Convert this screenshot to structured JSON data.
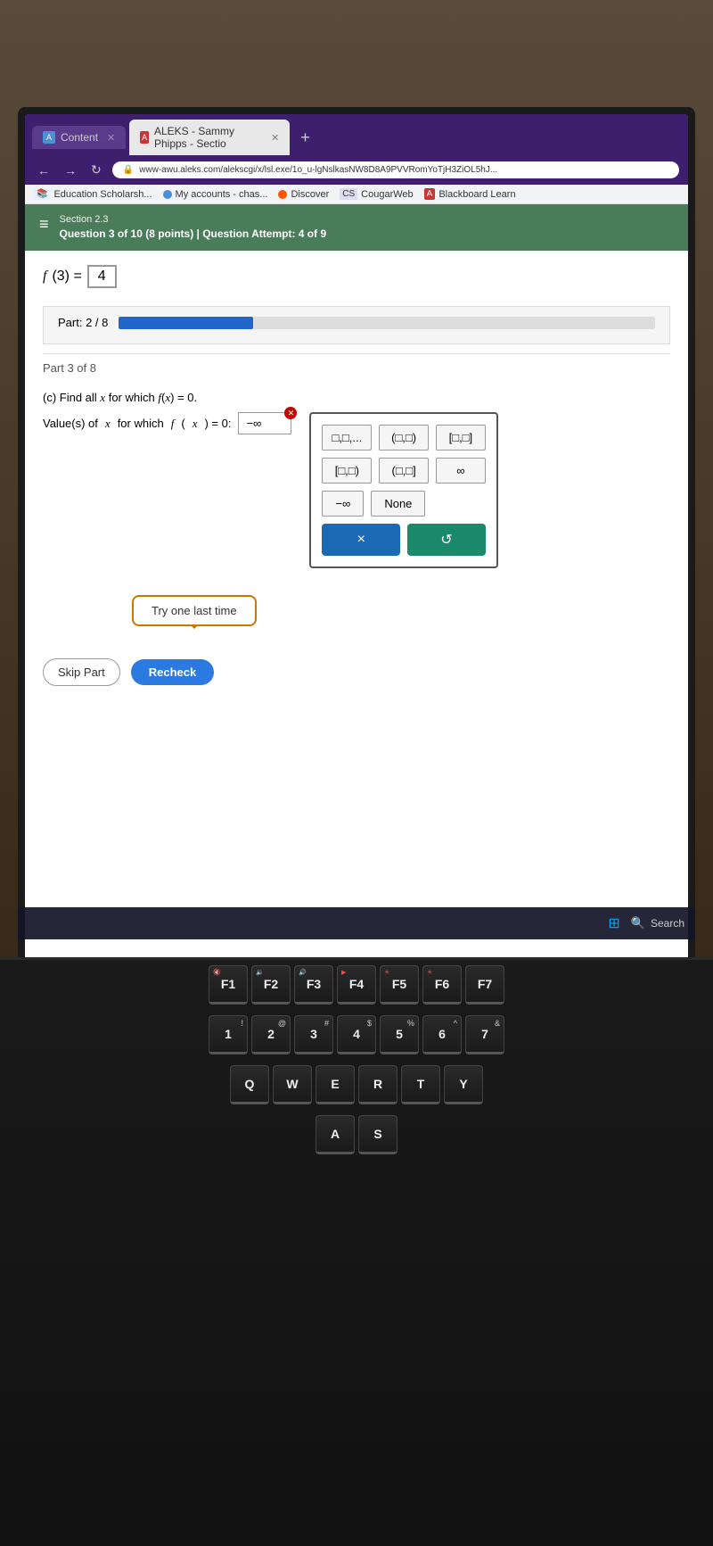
{
  "desk": {
    "bg_color": "#3a2a1a"
  },
  "browser": {
    "tabs": [
      {
        "id": "tab1",
        "label": "Content",
        "icon_color": "#4a90d9",
        "active": false,
        "icon": "A"
      },
      {
        "id": "tab2",
        "label": "ALEKS - Sammy Phipps - Sectio",
        "icon_color": "#cc3333",
        "active": true,
        "icon": "A"
      }
    ],
    "url": "www-awu.aleks.com/alekscgi/x/lsl.exe/1o_u-lgNslkasNW8D8A9PVVRomYoTjH3ZiOL5hJ...",
    "bookmarks": [
      {
        "label": "Education Scholarsh...",
        "type": "image"
      },
      {
        "label": "My accounts - chas...",
        "type": "circle",
        "color": "#4a90d9"
      },
      {
        "label": "Discover",
        "type": "circle",
        "color": "#ff5500"
      },
      {
        "label": "CougarWeb",
        "type": "image"
      },
      {
        "label": "Blackboard Learn",
        "type": "A_icon"
      }
    ]
  },
  "aleks": {
    "section": "Section 2.3",
    "question_info": "Question 3 of 10 (8 points)  |  Question Attempt: 4 of 9",
    "f3_equation": "f(3) =",
    "f3_answer": "4",
    "progress": {
      "label": "Part: 2 / 8",
      "fill_percent": 25
    },
    "part_label": "Part 3 of 8",
    "part_c_text": "(c) Find all x for which f(x) = 0.",
    "value_label": "Value(s) of x for which f(x) = 0:",
    "input_value": "−∞",
    "interval_popup": {
      "row1": [
        "□,□,...",
        "(□,□)",
        "[□,□]"
      ],
      "row2": [
        "[□,□)",
        "(□,□]",
        "∞"
      ],
      "special": [
        "−∞",
        "None"
      ],
      "btn_clear": "×",
      "btn_undo": "↺"
    },
    "try_again": "Try one last time",
    "btn_skip": "Skip Part",
    "btn_recheck": "Recheck"
  },
  "taskbar": {
    "search_label": "Search",
    "windows_icon": "⊞"
  },
  "keyboard": {
    "row1": [
      "F1",
      "F2",
      "F3",
      "F4",
      "F5",
      "F6",
      "F7"
    ],
    "row2": [
      "1",
      "2",
      "3",
      "4",
      "5",
      "6",
      "7"
    ],
    "row3": [
      "Q",
      "W",
      "E",
      "R",
      "T",
      "Y"
    ],
    "row4": [
      "A",
      "S"
    ]
  }
}
